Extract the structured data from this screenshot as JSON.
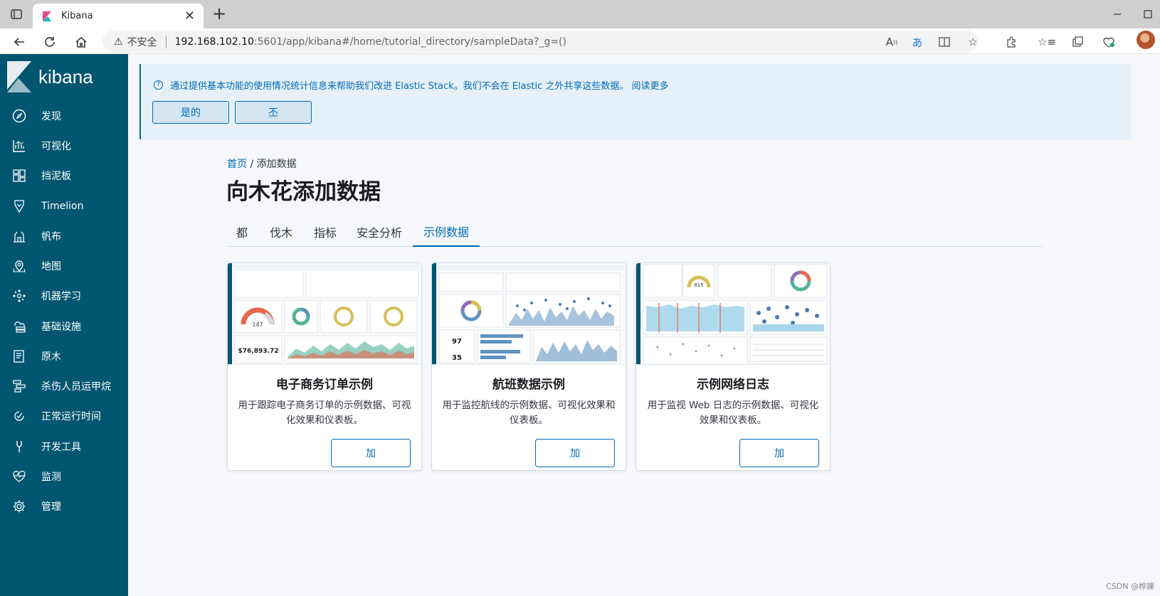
{
  "browser": {
    "tab_title": "Kibana",
    "insecure_label": "不安全",
    "url_host": "192.168.102.10",
    "url_path": ":5601/app/kibana#/home/tutorial_directory/sampleData?_g=()"
  },
  "sidebar": {
    "brand": "kibana",
    "items": [
      {
        "label": "发现",
        "icon": "compass-icon"
      },
      {
        "label": "可视化",
        "icon": "chart-icon"
      },
      {
        "label": "挡泥板",
        "icon": "dashboard-icon"
      },
      {
        "label": "Timelion",
        "icon": "timelion-icon"
      },
      {
        "label": "帆布",
        "icon": "canvas-icon"
      },
      {
        "label": "地图",
        "icon": "map-icon"
      },
      {
        "label": "机器学习",
        "icon": "ml-icon"
      },
      {
        "label": "基础设施",
        "icon": "infra-icon"
      },
      {
        "label": "原木",
        "icon": "logs-icon"
      },
      {
        "label": "杀伤人员运甲烷",
        "icon": "apm-icon"
      },
      {
        "label": "正常运行时间",
        "icon": "uptime-icon"
      },
      {
        "label": "开发工具",
        "icon": "wrench-icon"
      },
      {
        "label": "监测",
        "icon": "heartbeat-icon"
      },
      {
        "label": "管理",
        "icon": "gear-icon"
      }
    ]
  },
  "callout": {
    "message": "通过提供基本功能的使用情况统计信息来帮助我们改进 Elastic Stack。我们不会在 Elastic 之外共享这些数据。 阅读更多",
    "yes_label": "是的",
    "no_label": "丕"
  },
  "breadcrumb": {
    "home": "首页",
    "separator": "/",
    "current": "添加数据"
  },
  "page_title": "向木花添加数据",
  "tabs": [
    {
      "label": "都",
      "active": false
    },
    {
      "label": "伐木",
      "active": false
    },
    {
      "label": "指标",
      "active": false
    },
    {
      "label": "安全分析",
      "active": false
    },
    {
      "label": "示例数据",
      "active": true
    }
  ],
  "cards": [
    {
      "title": "电子商务订单示例",
      "description": "用于跟踪电子商务订单的示例数据、可视化效果和仪表板。",
      "button": "加",
      "thumb_value": "$76,893.72",
      "thumb_gauge": "147"
    },
    {
      "title": "航班数据示例",
      "description": "用于监控航线的示例数据、可视化效果和仪表板。",
      "button": "加",
      "thumb_value_1": "97",
      "thumb_value_2": "35"
    },
    {
      "title": "示例网络日志",
      "description": "用于监视 Web 日志的示例数据、可视化效果和仪表板。",
      "button": "加",
      "thumb_gauge": "815"
    }
  ],
  "watermark": "CSDN @桦鑠",
  "colors": {
    "sidebar": "#005571",
    "accent": "#006bb4",
    "page_bg": "#f5f7fa"
  }
}
